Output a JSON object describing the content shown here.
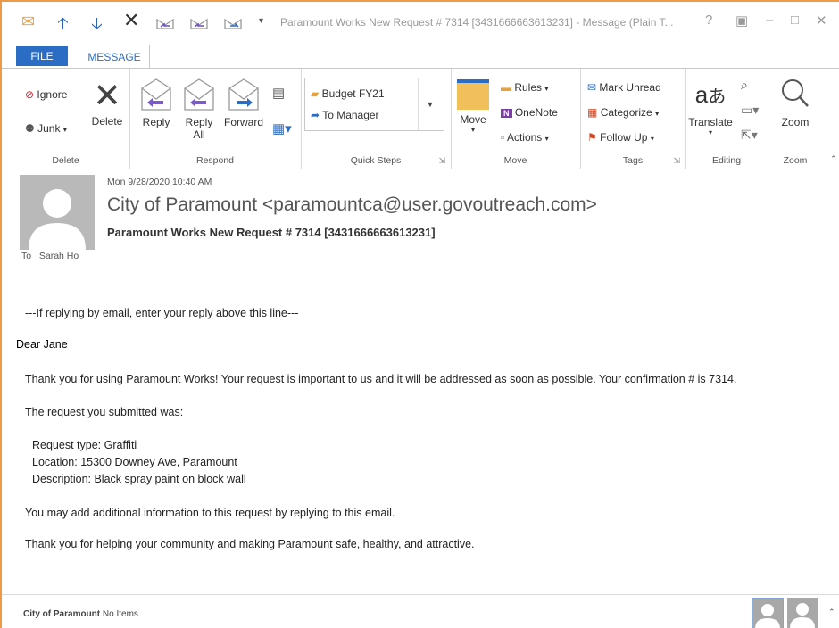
{
  "titlebar": {
    "title": "Paramount Works New Request # 7314 [3431666663613231] - Message (Plain T...",
    "icons": [
      "mail-icon",
      "up-arrow-icon",
      "down-arrow-icon",
      "close-x-icon",
      "reply-icon",
      "reply-all-icon",
      "forward-icon",
      "customize-icon"
    ],
    "window_controls": [
      "?",
      "▣",
      "–",
      "□",
      "✕"
    ]
  },
  "tabs": {
    "file": "FILE",
    "message": "MESSAGE"
  },
  "ribbon": {
    "delete_group": {
      "ignore": "Ignore",
      "junk": "Junk",
      "delete": "Delete",
      "label": "Delete"
    },
    "respond_group": {
      "reply": "Reply",
      "reply_all_1": "Reply",
      "reply_all_2": "All",
      "forward": "Forward",
      "label": "Respond"
    },
    "quick_steps_group": {
      "budget": "Budget FY21",
      "to_manager": "To Manager",
      "label": "Quick Steps"
    },
    "move_group": {
      "move": "Move",
      "rules": "Rules",
      "onenote": "OneNote",
      "actions": "Actions",
      "label": "Move"
    },
    "tags_group": {
      "mark_unread": "Mark Unread",
      "categorize": "Categorize",
      "follow_up": "Follow Up",
      "label": "Tags"
    },
    "editing_group": {
      "translate": "Translate",
      "label": "Editing"
    },
    "zoom_group": {
      "zoom": "Zoom",
      "label": "Zoom"
    }
  },
  "header": {
    "date": "Mon 9/28/2020 10:40 AM",
    "sender": "City of Paramount <paramountca@user.govoutreach.com>",
    "subject": "Paramount Works New Request # 7314 [3431666663613231]",
    "to_label": "To",
    "to_name": "Sarah Ho"
  },
  "body": {
    "reply_line": "---If replying by email, enter your reply above this line---",
    "greeting": "Dear Jane",
    "thank_you": "Thank you for using Paramount Works! Your request is important to us and it will be addressed as soon as possible. Your confirmation # is 7314.",
    "submitted_intro": "The request you submitted was:",
    "request_type": "Request type: Graffiti",
    "location": "Location: 15300 Downey Ave, Paramount",
    "description": "Description:  Black spray paint on block wall",
    "add_info": "You may add additional information to this request by replying to this email.",
    "closing": "Thank you for helping your community and making Paramount safe, healthy, and attractive."
  },
  "footer": {
    "sender_name": "City of Paramount",
    "items_text": "No Items"
  },
  "colors": {
    "accent": "#2b6cc4",
    "frame": "#ec9a47",
    "avatar": "#b9b9b9"
  }
}
